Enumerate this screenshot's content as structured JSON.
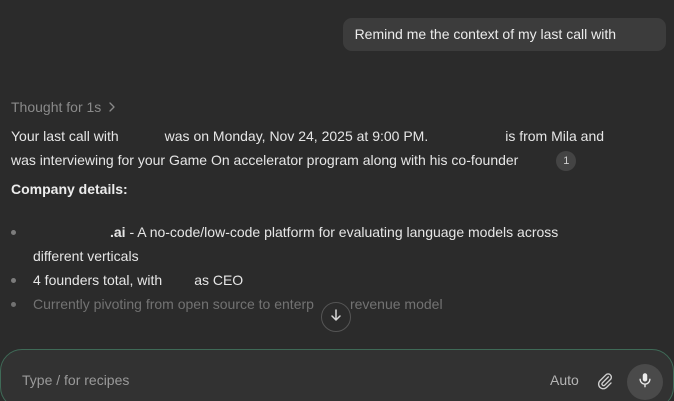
{
  "user_message": {
    "text": "Remind me the context of my last call with"
  },
  "thought": {
    "label": "Thought for 1s"
  },
  "answer": {
    "p1_a": "Your last call with",
    "p1_b": "was on Monday, Nov 24, 2025 at 9:00 PM.",
    "p1_c": "is from Mila and",
    "p2_a": "was interviewing for your Game On accelerator program along with his co-founder",
    "citation": "1"
  },
  "company_details": {
    "heading": "Company details:",
    "bullets": [
      {
        "bold": ".ai",
        "text": " - A no-code/low-code platform for evaluating language models across",
        "cont": "different verticals"
      },
      {
        "a": "4 founders total, with",
        "b": "as CEO"
      },
      {
        "a": "Currently pivoting from open source to enterp",
        "b": "revenue model"
      }
    ]
  },
  "composer": {
    "placeholder": "Type / for recipes",
    "mode_label": "Auto"
  },
  "colors": {
    "background": "#2b2b2b",
    "bubble": "#3c3c3c",
    "composer_border": "#3f6a57",
    "muted_text": "#8a8a8a"
  },
  "icons": {
    "thought_toggle": "chevron-right-icon",
    "scroll": "arrow-down-icon",
    "attach": "paperclip-icon",
    "voice": "microphone-icon"
  }
}
